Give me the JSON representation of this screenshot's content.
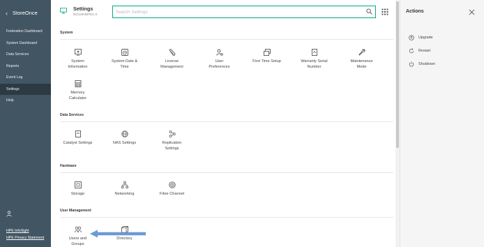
{
  "app": {
    "name": "StoreOnce"
  },
  "sidebar": {
    "items": [
      {
        "label": "Federation Dashboard"
      },
      {
        "label": "System Dashboard"
      },
      {
        "label": "Data Services"
      },
      {
        "label": "Reports"
      },
      {
        "label": "Event Log"
      },
      {
        "label": "Settings",
        "active": true
      },
      {
        "label": "Help"
      }
    ],
    "links": [
      {
        "label": "HPE InfoSight"
      },
      {
        "label": "HPE Privacy Statement"
      }
    ]
  },
  "header": {
    "title": "Settings",
    "subtitle": "SO1UKDPD1-3",
    "search_placeholder": "Search Settings"
  },
  "sections": {
    "system": {
      "title": "System",
      "tiles": [
        {
          "icon": "system-information-icon",
          "label1": "System",
          "label2": "Information"
        },
        {
          "icon": "clock-icon",
          "label1": "System Date &",
          "label2": "Time"
        },
        {
          "icon": "license-icon",
          "label1": "License",
          "label2": "Management"
        },
        {
          "icon": "user-preferences-icon",
          "label1": "User",
          "label2": "Preferences"
        },
        {
          "icon": "first-time-setup-icon",
          "label1": "First Time Setup",
          "label2": ""
        },
        {
          "icon": "warranty-icon",
          "label1": "Warranty Serial",
          "label2": "Number"
        },
        {
          "icon": "wrench-icon",
          "label1": "Maintenance",
          "label2": "Mode"
        },
        {
          "icon": "calculator-icon",
          "label1": "Memory",
          "label2": "Calculator"
        }
      ]
    },
    "data_services": {
      "title": "Data Services",
      "tiles": [
        {
          "icon": "catalyst-icon",
          "label1": "Catalyst Settings",
          "label2": ""
        },
        {
          "icon": "nas-icon",
          "label1": "NAS Settings",
          "label2": ""
        },
        {
          "icon": "replication-icon",
          "label1": "Replication",
          "label2": "Settings"
        }
      ]
    },
    "hardware": {
      "title": "Hardware",
      "tiles": [
        {
          "icon": "storage-icon",
          "label1": "Storage",
          "label2": ""
        },
        {
          "icon": "networking-icon",
          "label1": "Networking",
          "label2": ""
        },
        {
          "icon": "fibre-channel-icon",
          "label1": "Fibre Channel",
          "label2": ""
        }
      ]
    },
    "user_management": {
      "title": "User Management",
      "tiles": [
        {
          "icon": "users-groups-icon",
          "label1": "Users and",
          "label2": "Groups"
        },
        {
          "icon": "directory-icon",
          "label1": "Directory",
          "label2": ""
        }
      ]
    }
  },
  "actions": {
    "title": "Actions",
    "items": [
      {
        "label": "Upgrade"
      },
      {
        "label": "Restart"
      },
      {
        "label": "Shutdown"
      }
    ]
  },
  "colors": {
    "sidebar": "#425563",
    "sidebar_active": "#2c3a44",
    "accent": "#01a982",
    "annotation_arrow": "#5b8fd0"
  }
}
